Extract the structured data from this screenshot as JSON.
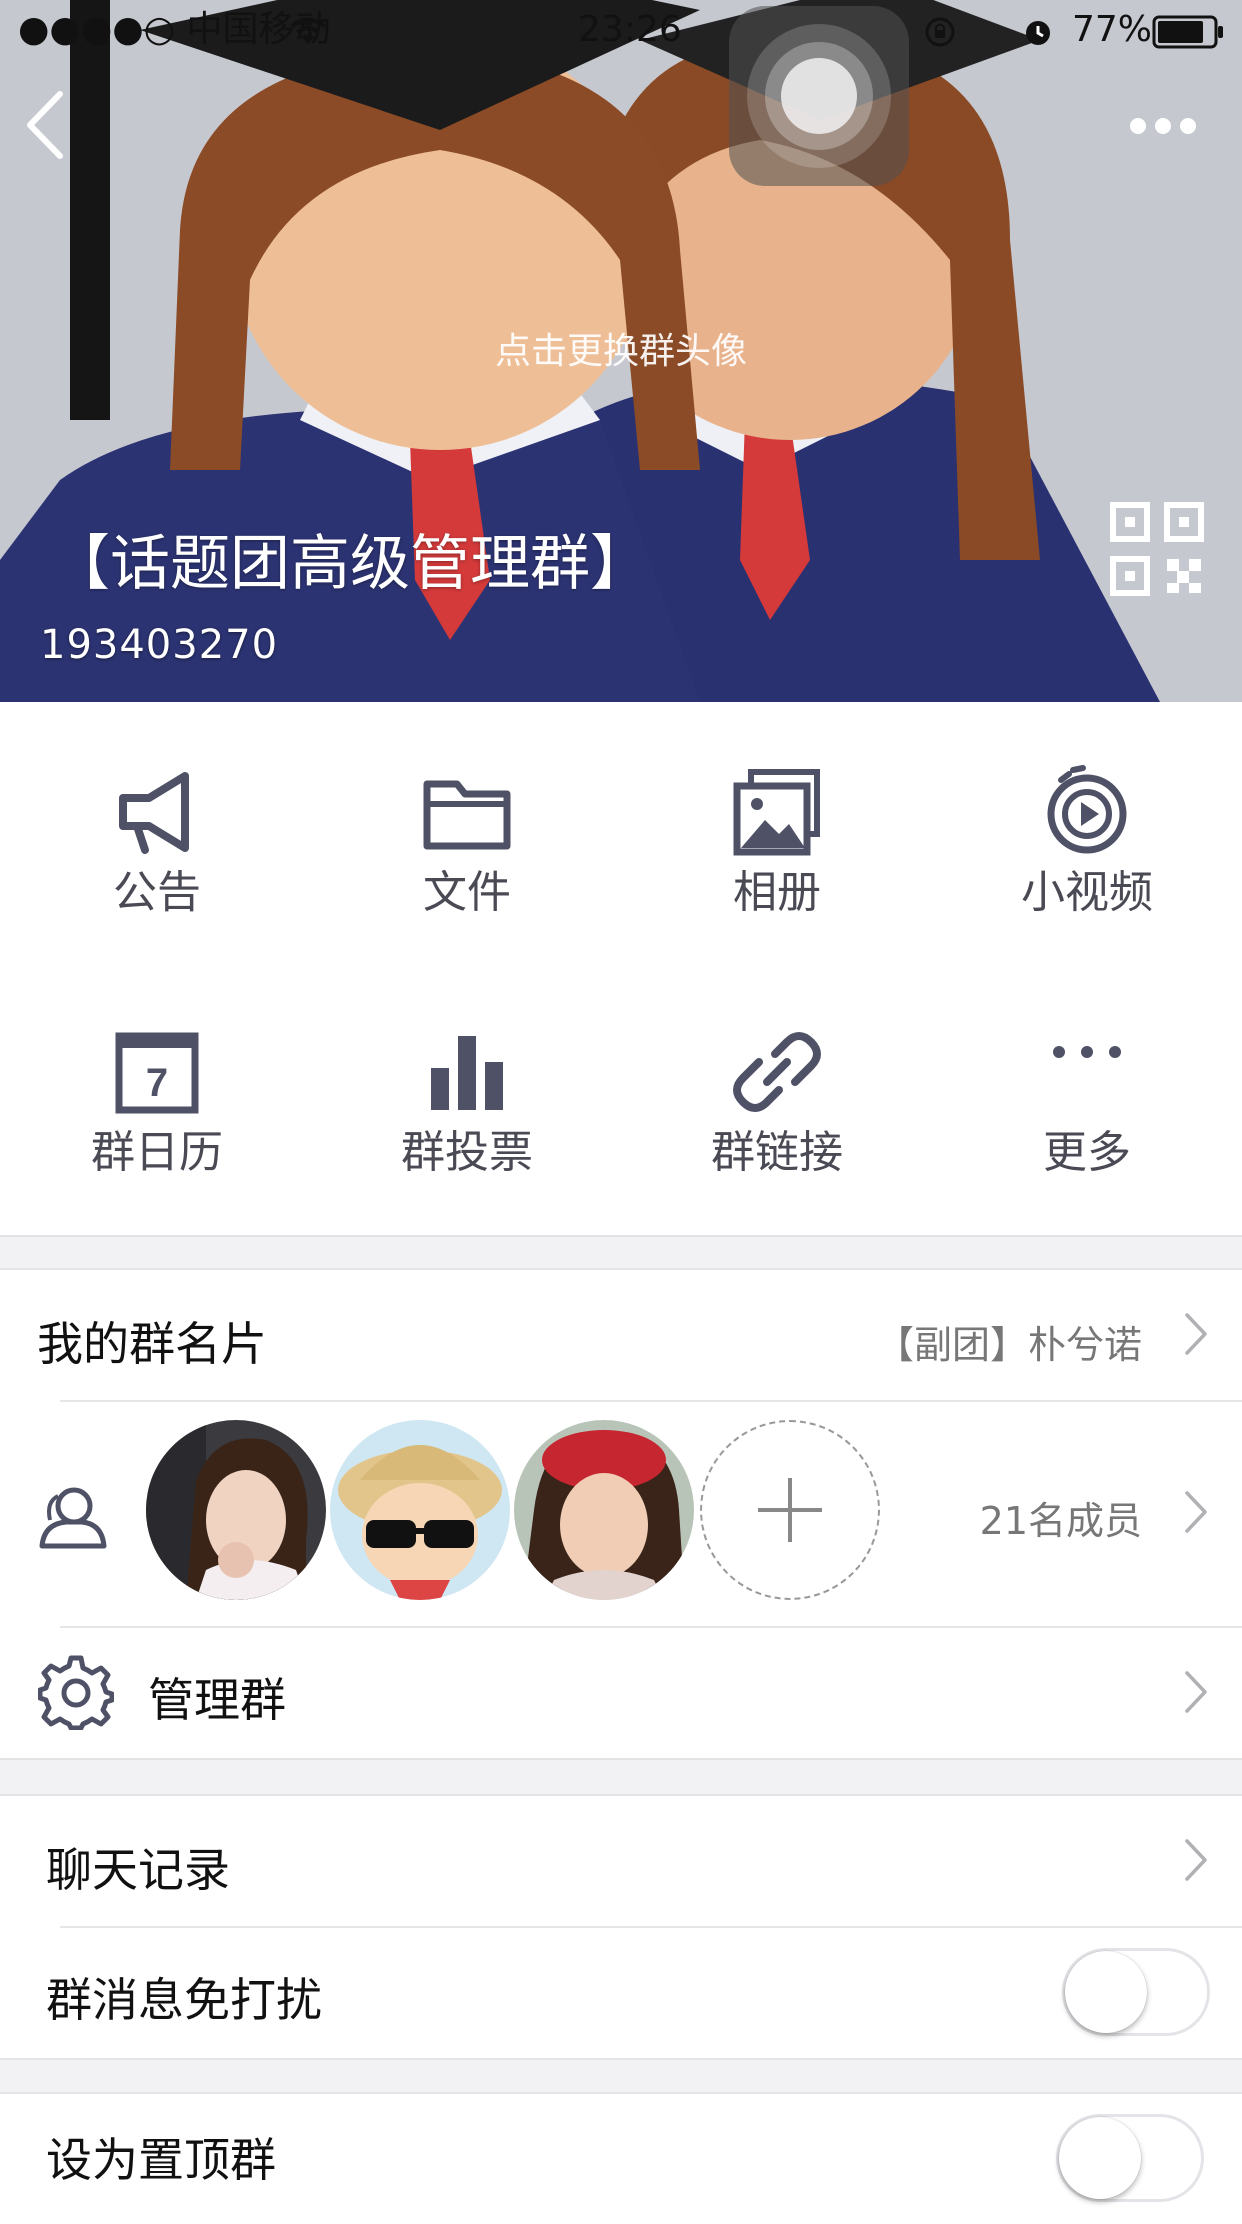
{
  "status_bar": {
    "carrier": "●●●●○ 中国移动",
    "time": "23:26",
    "battery": "77%"
  },
  "header": {
    "hint": "点击更换群头像",
    "group_name": "【话题团高级管理群】",
    "group_id": "193403270"
  },
  "features": [
    {
      "label": "公告",
      "icon": "megaphone-icon"
    },
    {
      "label": "文件",
      "icon": "folder-icon"
    },
    {
      "label": "相册",
      "icon": "photo-album-icon"
    },
    {
      "label": "小视频",
      "icon": "video-icon"
    },
    {
      "label": "群日历",
      "icon": "calendar-icon",
      "icon_text": "7"
    },
    {
      "label": "群投票",
      "icon": "bar-chart-icon"
    },
    {
      "label": "群链接",
      "icon": "link-icon"
    },
    {
      "label": "更多",
      "icon": "more-dots-icon"
    }
  ],
  "card": {
    "label": "我的群名片",
    "value": "【副团】朴兮诺"
  },
  "members": {
    "count_label": "21名成员",
    "icon": "members-icon"
  },
  "manage": {
    "label": "管理群",
    "icon": "gear-icon"
  },
  "chat_history": {
    "label": "聊天记录"
  },
  "mute": {
    "label": "群消息免打扰",
    "on": false
  },
  "pin": {
    "label": "设为置顶群",
    "on": false
  },
  "colors": {
    "icon_gray": "#4f5266",
    "text_gray": "#777777",
    "background": "#f2f2f4"
  }
}
